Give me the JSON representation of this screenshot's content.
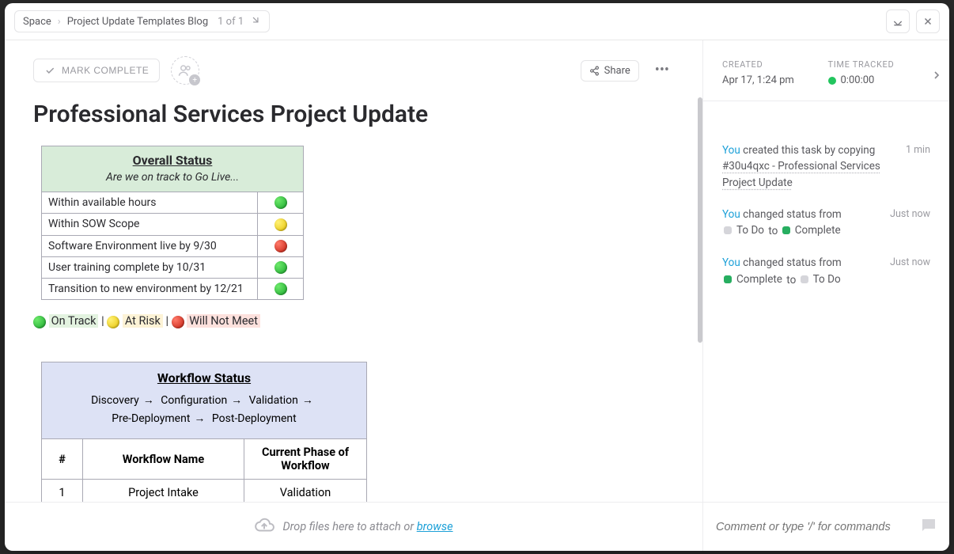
{
  "breadcrumb": {
    "root": "Space",
    "page": "Project Update Templates Blog",
    "count": "1 of 1"
  },
  "toolbar": {
    "mark_complete": "MARK COMPLETE",
    "share": "Share"
  },
  "title": "Professional Services Project Update",
  "overall_status": {
    "heading": "Overall Status",
    "subheading": "Are we on track to Go Live...",
    "rows": [
      {
        "label": "Within available hours",
        "color": "green"
      },
      {
        "label": "Within SOW Scope",
        "color": "yellow"
      },
      {
        "label": "Software Environment live by 9/30",
        "color": "red"
      },
      {
        "label": "User training complete by 10/31",
        "color": "green"
      },
      {
        "label": "Transition to new environment by 12/21",
        "color": "green"
      }
    ]
  },
  "legend": {
    "on_track": "On Track",
    "at_risk": "At Risk",
    "will_not_meet": "Will Not Meet",
    "separator": " | "
  },
  "workflow": {
    "heading": "Workflow Status",
    "steps": [
      "Discovery",
      "Configuration",
      "Validation",
      "Pre-Deployment",
      "Post-Deployment"
    ],
    "columns": {
      "num": "#",
      "name": "Workflow Name",
      "phase": "Current Phase of Workflow"
    },
    "rows": [
      {
        "num": "1",
        "name": "Project Intake",
        "phase": "Validation"
      }
    ]
  },
  "sidebar": {
    "created_label": "CREATED",
    "created_value": "Apr 17, 1:24 pm",
    "time_label": "TIME TRACKED",
    "time_value": "0:00:00"
  },
  "activity": {
    "you": "You",
    "items": [
      {
        "prefix": " created this task by copying ",
        "link": "#30u4qxc - Professional Services Project Update",
        "time": "1 min"
      },
      {
        "prefix": " changed status from",
        "from_color": "grey",
        "from_label": "To Do",
        "to_word": "to",
        "to_color": "green",
        "to_label": "Complete",
        "time": "Just now"
      },
      {
        "prefix": " changed status from",
        "from_color": "green",
        "from_label": "Complete",
        "to_word": "to",
        "to_color": "grey",
        "to_label": "To Do",
        "time": "Just now"
      }
    ]
  },
  "footer": {
    "drop_prefix": "Drop files here to attach or ",
    "browse": "browse",
    "comment_placeholder": "Comment or type '/' for commands"
  }
}
